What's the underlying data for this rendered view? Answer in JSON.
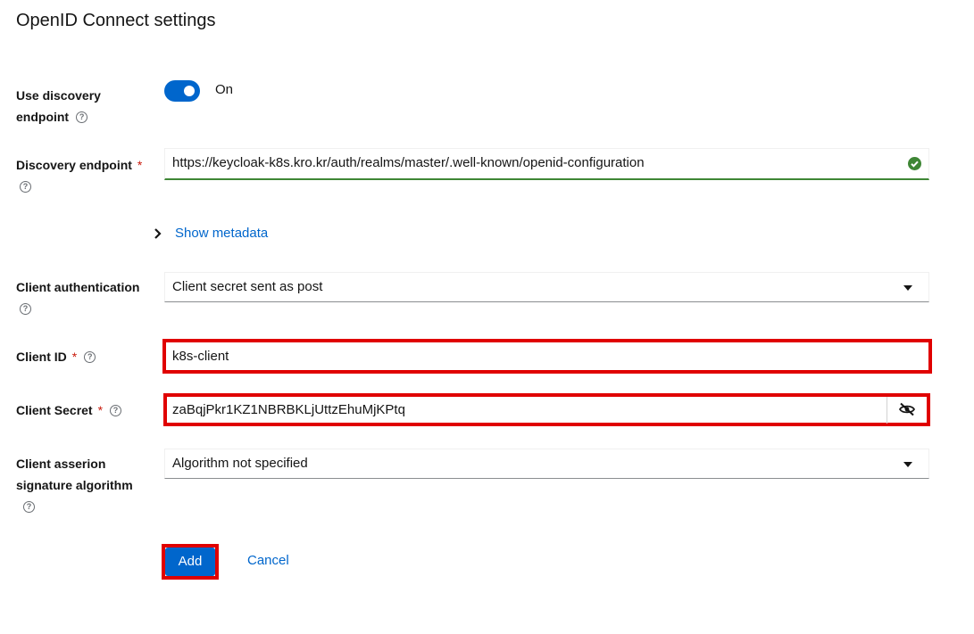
{
  "page": {
    "title": "OpenID Connect settings"
  },
  "discovery": {
    "label_line1": "Use discovery",
    "label_line2": "endpoint",
    "toggle_state": "On",
    "toggle_on": true
  },
  "discovery_endpoint": {
    "label": "Discovery endpoint",
    "required_mark": "*",
    "value": "https://keycloak-k8s.kro.kr/auth/realms/master/.well-known/openid-configuration"
  },
  "metadata": {
    "link_label": "Show metadata"
  },
  "client_auth": {
    "label": "Client authentication",
    "value": "Client secret sent as post"
  },
  "client_id": {
    "label": "Client ID",
    "required_mark": "*",
    "value": "k8s-client"
  },
  "client_secret": {
    "label": "Client Secret",
    "required_mark": "*",
    "value": "zaBqjPkr1KZ1NBRBKLjUttzEhuMjKPtq"
  },
  "assertion_alg": {
    "label_line1": "Client asserion",
    "label_line2": "signature algorithm",
    "value": "Algorithm not specified"
  },
  "actions": {
    "add_label": "Add",
    "cancel_label": "Cancel"
  },
  "icons": {
    "help": "?"
  },
  "colors": {
    "primary": "#0066cc",
    "success": "#3e8635",
    "highlight": "#e00000",
    "required": "#c9190b"
  }
}
